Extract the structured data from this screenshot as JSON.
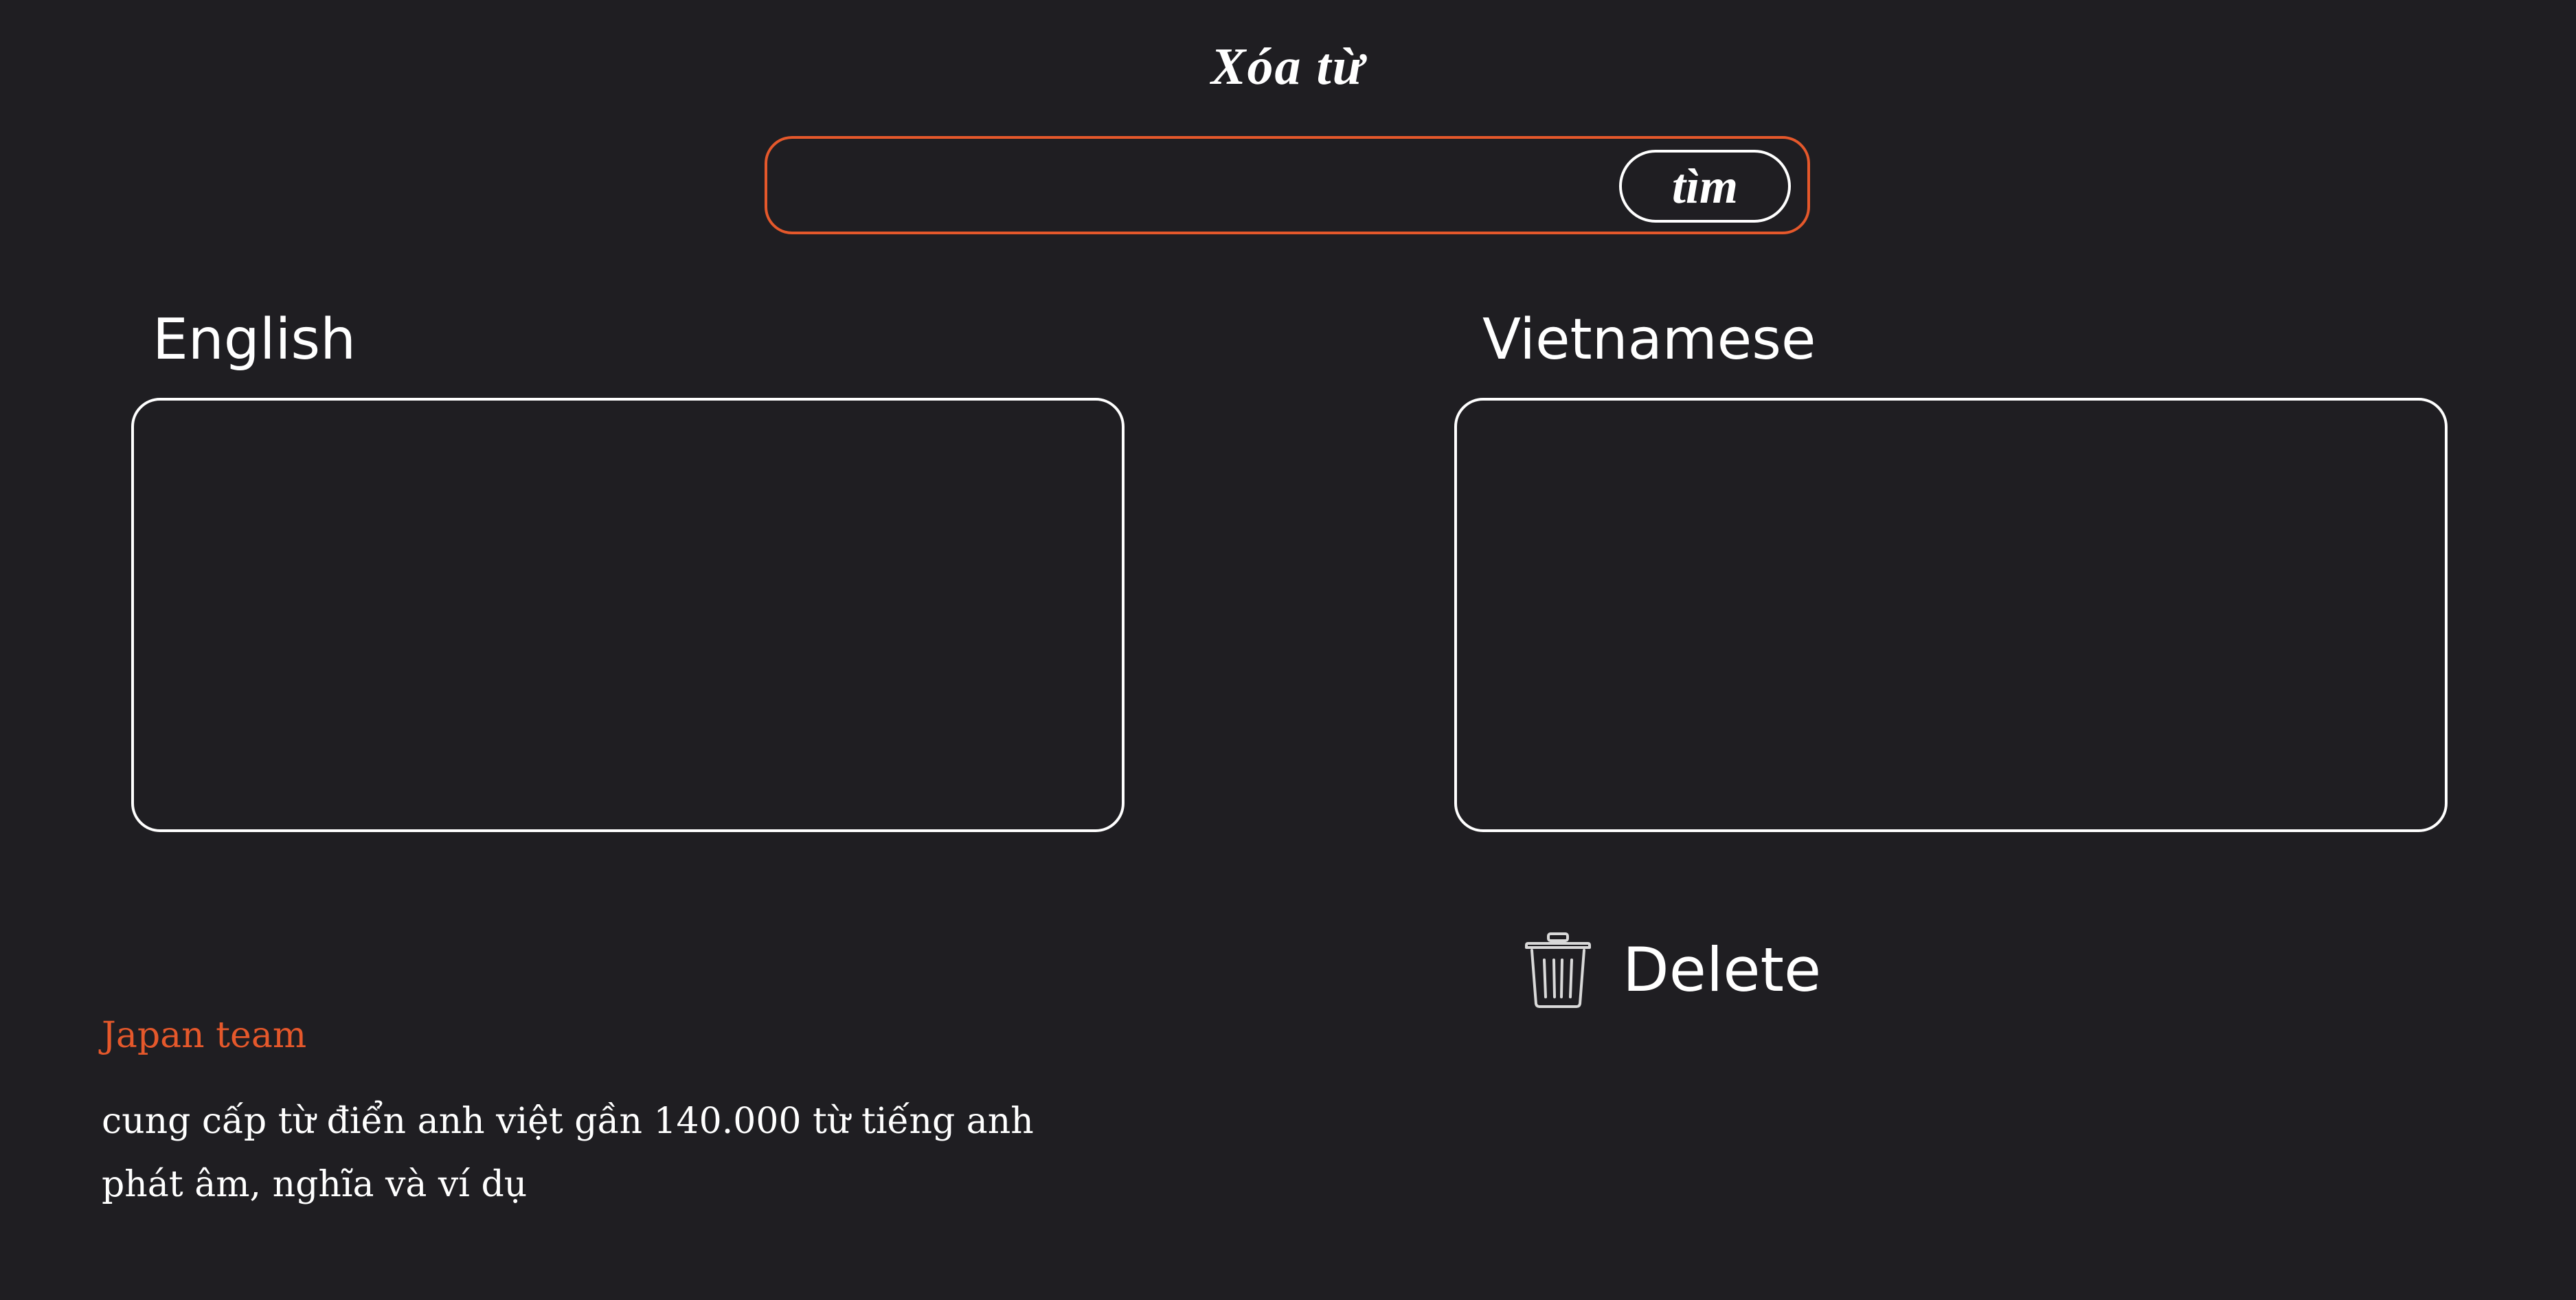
{
  "page": {
    "title": "Xóa từ"
  },
  "search": {
    "value": "",
    "placeholder": "",
    "button_label": "tìm"
  },
  "panels": {
    "english": {
      "label": "English",
      "value": ""
    },
    "vietnamese": {
      "label": "Vietnamese",
      "value": ""
    }
  },
  "actions": {
    "delete_label": "Delete",
    "delete_icon": "trash-icon"
  },
  "footer": {
    "team": "Japan team",
    "description_lines": [
      "cung cấp từ điển anh việt gần 140.000 từ tiếng anh",
      "phát âm, nghĩa và ví dụ"
    ]
  },
  "colors": {
    "background": "#1f1e22",
    "accent": "#e5582b",
    "text": "#ffffff",
    "icon": "#d9d9d9"
  }
}
